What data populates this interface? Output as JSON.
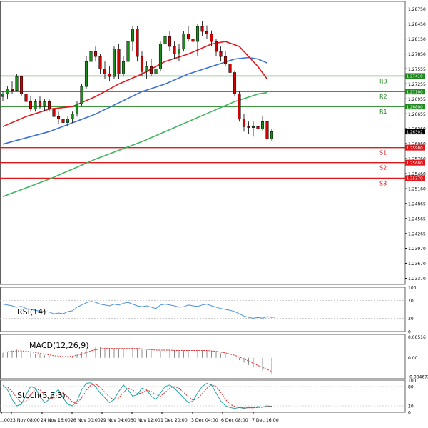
{
  "chart_data": {
    "type": "candlestick",
    "colors": {
      "bull": "#1a8a1a",
      "bear": "#d40000",
      "ma_fast": "#e3161b",
      "ma_mid": "#3b6fd8",
      "ma_slow": "#3fb45f",
      "resistance": "#1f8a1f",
      "support": "#e3161b",
      "osc_line": "#4a90d9",
      "osc_signal": "#d93030",
      "hist": "#8c8c8c",
      "panel_border": "#606060"
    },
    "price_axis": {
      "ylim": [
        1.2325,
        1.289
      ],
      "ticks": [
        "1.28750",
        "1.28450",
        "1.28150",
        "1.27850",
        "1.27555",
        "1.27255",
        "1.26955",
        "1.26655",
        "1.26360",
        "1.26060",
        "1.25760",
        "1.25460",
        "1.25160",
        "1.24865",
        "1.24565",
        "1.24265",
        "1.23970",
        "1.23670",
        "1.23370"
      ]
    },
    "x_labels": [
      "...00",
      "23 Nov 08:00",
      "24 Nov 16:00",
      "26 Nov 00:00",
      "29 Nov 04:00",
      "30 Nov 12:00",
      "1 Dec 20:00",
      "3 Dec 04:00",
      "6 Dec 08:00",
      "7 Dec 16:00"
    ],
    "current_price": "1.26302",
    "levels": [
      {
        "name": "R3",
        "value": 1.2741,
        "label": "1.27410",
        "kind": "resistance"
      },
      {
        "name": "R2",
        "value": 1.271,
        "label": "1.27100",
        "kind": "resistance"
      },
      {
        "name": "R1",
        "value": 1.268,
        "label": "1.26800",
        "kind": "resistance"
      },
      {
        "name": "S1",
        "value": 1.2598,
        "label": "1.25980",
        "kind": "support"
      },
      {
        "name": "S2",
        "value": 1.2568,
        "label": "1.25680",
        "kind": "support"
      },
      {
        "name": "S3",
        "value": 1.2537,
        "label": "1.25370",
        "kind": "support"
      }
    ],
    "candles": [
      [
        1.27,
        1.271,
        1.269,
        1.2705
      ],
      [
        1.2705,
        1.272,
        1.2695,
        1.2715
      ],
      [
        1.2715,
        1.273,
        1.2705,
        1.2712
      ],
      [
        1.2712,
        1.2745,
        1.271,
        1.274
      ],
      [
        1.274,
        1.2742,
        1.27,
        1.2705
      ],
      [
        1.2705,
        1.2712,
        1.268,
        1.269
      ],
      [
        1.269,
        1.27,
        1.267,
        1.2675
      ],
      [
        1.2675,
        1.2695,
        1.267,
        1.269
      ],
      [
        1.269,
        1.27,
        1.2675,
        1.268
      ],
      [
        1.268,
        1.2695,
        1.267,
        1.269
      ],
      [
        1.269,
        1.2695,
        1.267,
        1.2675
      ],
      [
        1.2675,
        1.269,
        1.265,
        1.266
      ],
      [
        1.266,
        1.267,
        1.2645,
        1.2655
      ],
      [
        1.2655,
        1.2665,
        1.264,
        1.2648
      ],
      [
        1.2648,
        1.266,
        1.264,
        1.2655
      ],
      [
        1.2655,
        1.267,
        1.2648,
        1.2665
      ],
      [
        1.2665,
        1.269,
        1.266,
        1.2685
      ],
      [
        1.2685,
        1.2725,
        1.268,
        1.272
      ],
      [
        1.272,
        1.278,
        1.2715,
        1.277
      ],
      [
        1.277,
        1.2795,
        1.2755,
        1.279
      ],
      [
        1.279,
        1.28,
        1.277,
        1.278
      ],
      [
        1.278,
        1.2785,
        1.2745,
        1.2755
      ],
      [
        1.2755,
        1.277,
        1.2735,
        1.2745
      ],
      [
        1.2745,
        1.276,
        1.273,
        1.274
      ],
      [
        1.274,
        1.28,
        1.2735,
        1.2795
      ],
      [
        1.2795,
        1.2805,
        1.2735,
        1.2745
      ],
      [
        1.2745,
        1.278,
        1.274,
        1.277
      ],
      [
        1.277,
        1.2815,
        1.2765,
        1.281
      ],
      [
        1.281,
        1.284,
        1.279,
        1.2835
      ],
      [
        1.2835,
        1.284,
        1.277,
        1.278
      ],
      [
        1.278,
        1.279,
        1.274,
        1.275
      ],
      [
        1.275,
        1.277,
        1.2735,
        1.276
      ],
      [
        1.276,
        1.2775,
        1.274,
        1.2745
      ],
      [
        1.2745,
        1.276,
        1.271,
        1.2755
      ],
      [
        1.2755,
        1.281,
        1.275,
        1.2805
      ],
      [
        1.2805,
        1.283,
        1.2795,
        1.282
      ],
      [
        1.282,
        1.283,
        1.279,
        1.28
      ],
      [
        1.28,
        1.281,
        1.2775,
        1.2785
      ],
      [
        1.2785,
        1.2805,
        1.277,
        1.2795
      ],
      [
        1.2795,
        1.283,
        1.279,
        1.2825
      ],
      [
        1.2825,
        1.284,
        1.281,
        1.2815
      ],
      [
        1.2815,
        1.283,
        1.28,
        1.281
      ],
      [
        1.281,
        1.2845,
        1.278,
        1.284
      ],
      [
        1.284,
        1.285,
        1.282,
        1.283
      ],
      [
        1.283,
        1.2842,
        1.2815,
        1.2825
      ],
      [
        1.2825,
        1.2832,
        1.28,
        1.281
      ],
      [
        1.281,
        1.2815,
        1.278,
        1.279
      ],
      [
        1.279,
        1.28,
        1.277,
        1.278
      ],
      [
        1.278,
        1.279,
        1.276,
        1.2765
      ],
      [
        1.2765,
        1.277,
        1.274,
        1.2748
      ],
      [
        1.2748,
        1.2752,
        1.27,
        1.2705
      ],
      [
        1.2705,
        1.271,
        1.265,
        1.2655
      ],
      [
        1.2655,
        1.2665,
        1.263,
        1.264
      ],
      [
        1.264,
        1.265,
        1.2625,
        1.2638
      ],
      [
        1.2638,
        1.265,
        1.262,
        1.264
      ],
      [
        1.264,
        1.265,
        1.2628,
        1.2635
      ],
      [
        1.2635,
        1.266,
        1.2632,
        1.265
      ],
      [
        1.265,
        1.2658,
        1.2605,
        1.2615
      ],
      [
        1.2615,
        1.2635,
        1.2612,
        1.263
      ]
    ],
    "ma_fast": [
      [
        0,
        1.264
      ],
      [
        5,
        1.266
      ],
      [
        10,
        1.2675
      ],
      [
        15,
        1.268
      ],
      [
        20,
        1.27
      ],
      [
        25,
        1.2725
      ],
      [
        30,
        1.2745
      ],
      [
        35,
        1.277
      ],
      [
        40,
        1.2785
      ],
      [
        45,
        1.2805
      ],
      [
        48,
        1.281
      ],
      [
        51,
        1.28
      ],
      [
        55,
        1.276
      ],
      [
        57,
        1.2735
      ]
    ],
    "ma_mid": [
      [
        0,
        1.2605
      ],
      [
        10,
        1.263
      ],
      [
        20,
        1.2665
      ],
      [
        30,
        1.271
      ],
      [
        35,
        1.2725
      ],
      [
        40,
        1.2745
      ],
      [
        45,
        1.276
      ],
      [
        50,
        1.2775
      ],
      [
        53,
        1.2778
      ],
      [
        55,
        1.2775
      ],
      [
        57,
        1.2767
      ]
    ],
    "ma_slow": [
      [
        0,
        1.25
      ],
      [
        10,
        1.2535
      ],
      [
        20,
        1.2575
      ],
      [
        30,
        1.261
      ],
      [
        40,
        1.265
      ],
      [
        45,
        1.267
      ],
      [
        50,
        1.269
      ],
      [
        55,
        1.2705
      ],
      [
        57,
        1.2708
      ]
    ],
    "rsi": {
      "label": "RSI(14)",
      "ticks": [
        "100",
        "70",
        "30",
        "0"
      ],
      "ylim": [
        0,
        100
      ],
      "values": [
        62,
        60,
        58,
        55,
        57,
        52,
        50,
        48,
        46,
        45,
        44,
        40,
        42,
        40,
        45,
        47,
        55,
        60,
        65,
        68,
        66,
        62,
        60,
        58,
        62,
        60,
        64,
        66,
        62,
        58,
        56,
        58,
        55,
        52,
        60,
        62,
        60,
        58,
        55,
        56,
        60,
        58,
        57,
        60,
        62,
        58,
        55,
        52,
        50,
        48,
        45,
        40,
        35,
        32,
        30,
        32,
        30,
        34,
        32,
        33
      ]
    },
    "macd": {
      "label": "MACD(12,26,9)",
      "ticks": [
        "0.00516",
        "0.00",
        "-0.004672"
      ],
      "ylim": [
        -0.0052,
        0.0058
      ],
      "hist": [
        0.0012,
        0.0015,
        0.0018,
        0.002,
        0.0018,
        0.0016,
        0.0013,
        0.001,
        0.0008,
        0.0006,
        0.0004,
        0.0002,
        0.0001,
        0.0,
        0.0002,
        0.0004,
        0.0008,
        0.0014,
        0.002,
        0.0025,
        0.0027,
        0.0027,
        0.0025,
        0.0024,
        0.0024,
        0.0022,
        0.0022,
        0.0024,
        0.0025,
        0.0023,
        0.002,
        0.0019,
        0.0018,
        0.0016,
        0.0017,
        0.0019,
        0.0019,
        0.0018,
        0.0017,
        0.0017,
        0.0018,
        0.0018,
        0.0017,
        0.0018,
        0.0018,
        0.0016,
        0.0014,
        0.0011,
        0.0008,
        0.0004,
        0.0,
        -0.0006,
        -0.0012,
        -0.0018,
        -0.0024,
        -0.0028,
        -0.0032,
        -0.0036,
        -0.004
      ],
      "signal": [
        0.0014,
        0.0015,
        0.0016,
        0.0017,
        0.0017,
        0.0016,
        0.0015,
        0.0013,
        0.0011,
        0.0009,
        0.0007,
        0.0005,
        0.0004,
        0.0003,
        0.0003,
        0.0004,
        0.0006,
        0.0009,
        0.0013,
        0.0017,
        0.002,
        0.0022,
        0.0023,
        0.0023,
        0.0023,
        0.0023,
        0.0023,
        0.0023,
        0.0023,
        0.0023,
        0.0022,
        0.0021,
        0.002,
        0.0019,
        0.0019,
        0.0019,
        0.0019,
        0.0018,
        0.0018,
        0.0018,
        0.0018,
        0.0018,
        0.0018,
        0.0018,
        0.0018,
        0.0017,
        0.0016,
        0.0014,
        0.0012,
        0.0009,
        0.0006,
        0.0002,
        -0.0003,
        -0.0008,
        -0.0014,
        -0.0019,
        -0.0024,
        -0.0029,
        -0.0034
      ]
    },
    "stoch": {
      "label": "Stoch(5,5,3)",
      "ticks": [
        "100",
        "80",
        "20",
        "0"
      ],
      "ylim": [
        0,
        100
      ],
      "k": [
        85,
        70,
        40,
        20,
        25,
        55,
        80,
        75,
        50,
        30,
        40,
        60,
        70,
        45,
        25,
        20,
        35,
        70,
        90,
        92,
        80,
        60,
        45,
        30,
        40,
        65,
        85,
        70,
        50,
        55,
        75,
        70,
        50,
        40,
        60,
        80,
        85,
        75,
        60,
        45,
        30,
        35,
        60,
        80,
        90,
        85,
        60,
        35,
        20,
        15,
        12,
        15,
        12,
        15,
        14,
        18,
        16,
        20,
        18
      ],
      "d": [
        80,
        78,
        65,
        45,
        30,
        35,
        55,
        70,
        70,
        55,
        42,
        45,
        58,
        60,
        48,
        32,
        28,
        45,
        68,
        85,
        88,
        78,
        62,
        48,
        38,
        45,
        62,
        75,
        70,
        58,
        60,
        68,
        65,
        55,
        50,
        62,
        75,
        80,
        75,
        62,
        48,
        38,
        42,
        58,
        75,
        85,
        80,
        62,
        40,
        25,
        18,
        15,
        14,
        14,
        14,
        15,
        16,
        18,
        19
      ]
    }
  }
}
